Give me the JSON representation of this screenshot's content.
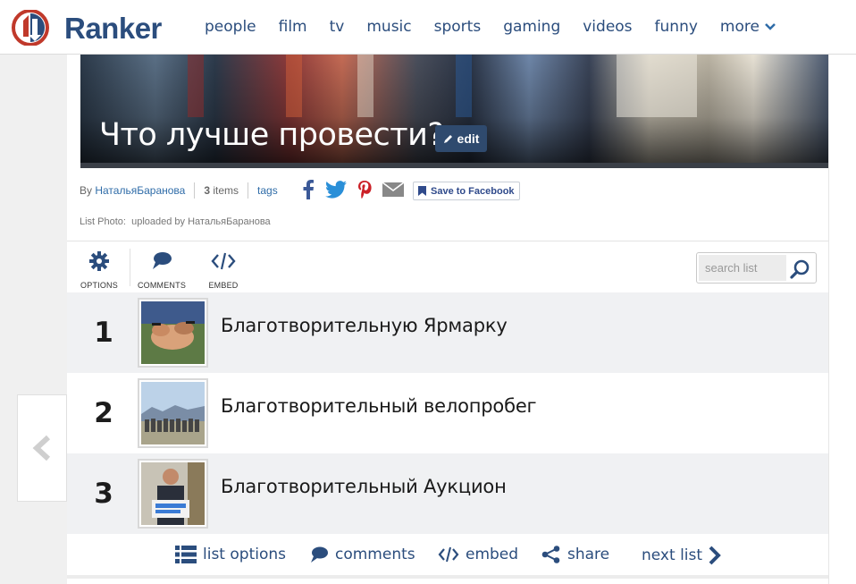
{
  "brand": {
    "name": "Ranker",
    "color": "#2b4d7d",
    "accent": "#c0392b"
  },
  "nav": {
    "links": [
      "people",
      "film",
      "tv",
      "music",
      "sports",
      "gaming",
      "videos",
      "funny"
    ],
    "more_label": "more"
  },
  "list": {
    "title": "Что лучше провести?",
    "edit_label": "edit",
    "byline_prefix": "By",
    "author": "НатальяБаранова",
    "items_count": "3",
    "items_label": "items",
    "tags_label": "tags",
    "save_label": "Save to Facebook",
    "photo_credit_label": "List Photo:",
    "photo_credit_text": "uploaded by НатальяБаранова"
  },
  "toolbar": {
    "options_label": "OPTIONS",
    "comments_label": "COMMENTS",
    "embed_label": "EMBED",
    "search_placeholder": "search list"
  },
  "items": [
    {
      "rank": "1",
      "title": "Благотворительную Ярмарку"
    },
    {
      "rank": "2",
      "title": "Благотворительный велопробег"
    },
    {
      "rank": "3",
      "title": "Благотворительный Аукцион"
    }
  ],
  "actions": {
    "list_options": "list options",
    "comments": "comments",
    "embed": "embed",
    "share": "share",
    "next_list": "next list"
  },
  "icons": {
    "facebook": "facebook-icon",
    "twitter": "twitter-icon",
    "pinterest": "pinterest-icon",
    "email": "email-icon",
    "bookmark": "bookmark-icon"
  }
}
